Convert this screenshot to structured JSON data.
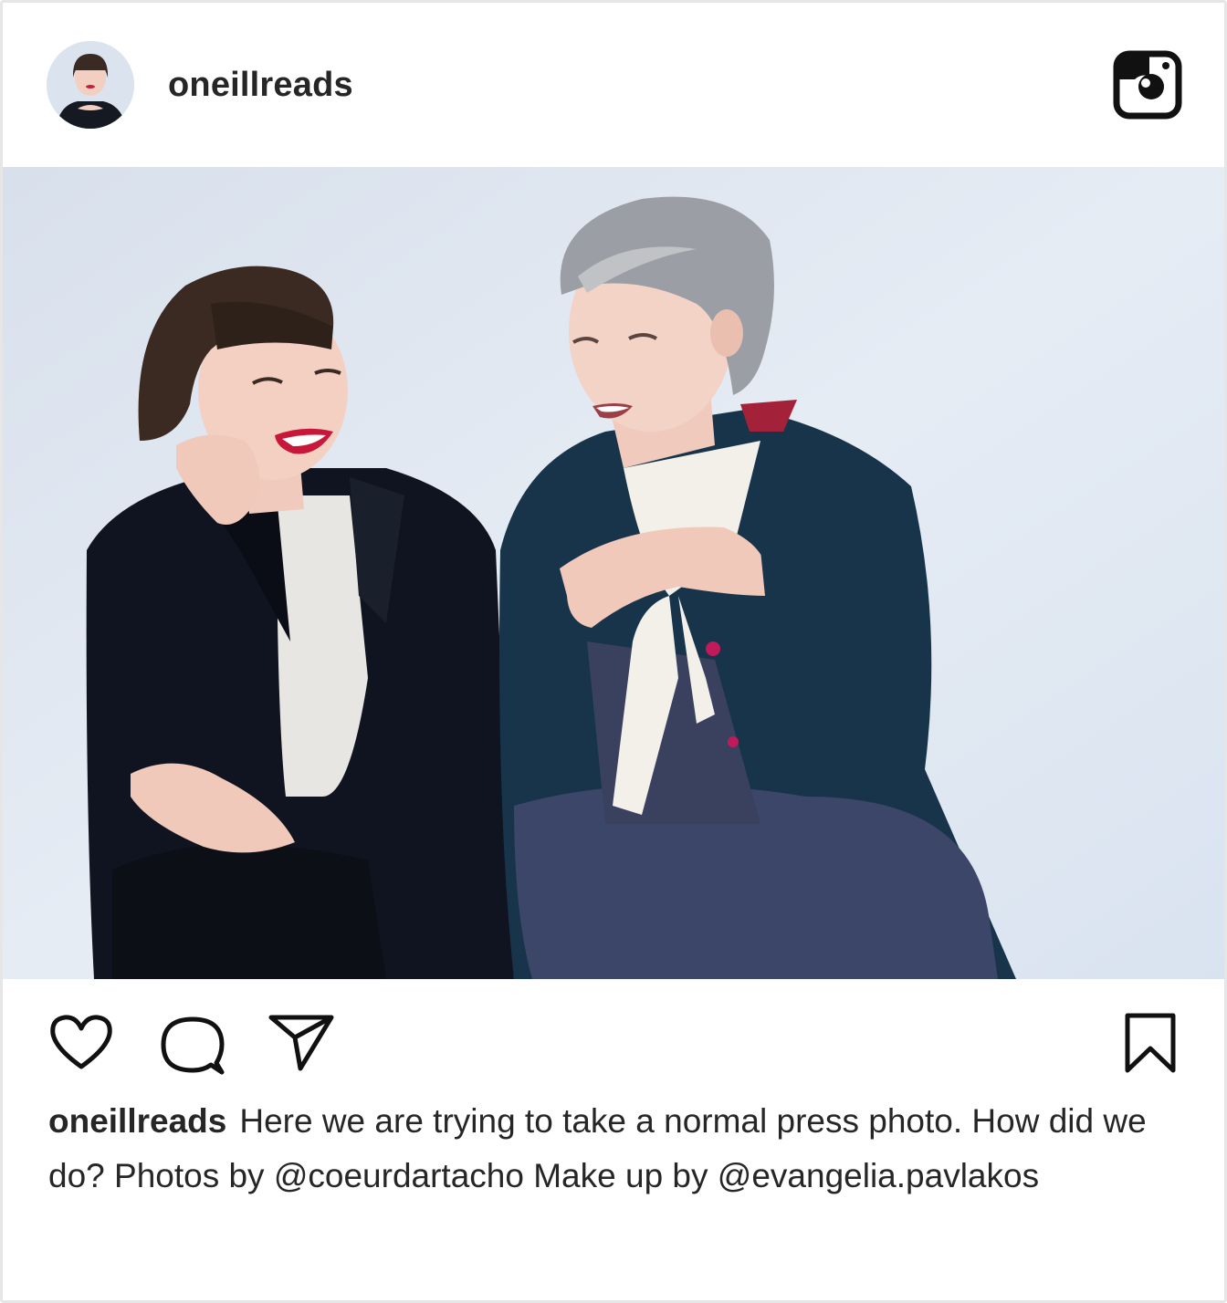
{
  "post": {
    "username": "oneillreads",
    "caption": {
      "username": "oneillreads",
      "text_before_mention_1": "Here we are trying to take a normal press photo. How did we do? Photos by ",
      "mention_1": "@coeurdartacho",
      "text_between_mentions": " Make up by ",
      "mention_2": "@evangelia.pavlakos"
    }
  },
  "icons": {
    "header_logo": "instagram-icon",
    "like": "heart-icon",
    "comment": "comment-icon",
    "share": "share-icon",
    "save": "bookmark-icon"
  },
  "colors": {
    "text": "#262626",
    "border": "#e6e6e6",
    "photo_background": "#dfe6f0"
  }
}
